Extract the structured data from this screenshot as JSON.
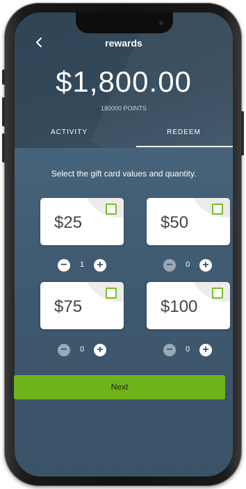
{
  "header": {
    "title": "rewards"
  },
  "balance": {
    "amount": "$1,800.00",
    "points": "180000 POINTS"
  },
  "tabs": [
    {
      "label": "ACTIVITY",
      "active": false
    },
    {
      "label": "REDEEM",
      "active": true
    }
  ],
  "instructions": "Select the gift card values and quantity.",
  "cards": [
    {
      "value": "$25",
      "quantity": "1"
    },
    {
      "value": "$50",
      "quantity": "0"
    },
    {
      "value": "$75",
      "quantity": "0"
    },
    {
      "value": "$100",
      "quantity": "0"
    }
  ],
  "next_button": {
    "label": "Next"
  },
  "colors": {
    "accent": "#6fb31a",
    "checkbox_border": "#78bd2a",
    "background": "#3b566d"
  }
}
